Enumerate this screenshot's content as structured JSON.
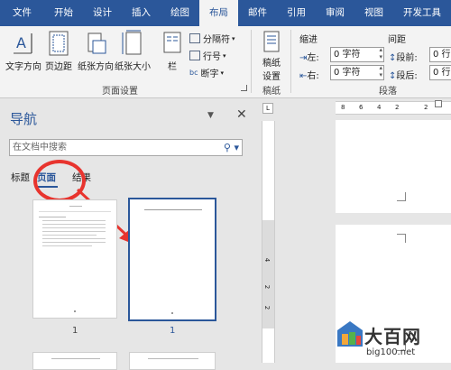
{
  "tabs": [
    "文件",
    "开始",
    "设计",
    "插入",
    "绘图",
    "布局",
    "邮件",
    "引用",
    "审阅",
    "视图",
    "开发工具"
  ],
  "ribbon": {
    "text_direction": "文字方向",
    "margins": "页边距",
    "orientation": "纸张方向",
    "size": "纸张大小",
    "columns": "栏",
    "breaks": "分隔符",
    "line_numbers": "行号",
    "hyphenation": "断字",
    "page_setup_group": "页面设置",
    "manuscript": "稿纸",
    "manuscript_setup": "设置",
    "manuscript_group": "稿纸",
    "indent_header": "缩进",
    "indent_left_label": "左:",
    "indent_left_value": "0 字符",
    "indent_right_label": "右:",
    "indent_right_value": "0 字符",
    "spacing_header": "间距",
    "spacing_before_label": "段前:",
    "spacing_before_value": "0 行",
    "spacing_after_label": "段后:",
    "spacing_after_value": "0 行",
    "paragraph_group": "段落"
  },
  "nav": {
    "title": "导航",
    "search_placeholder": "在文档中搜索",
    "tab_headings": "标题",
    "tab_pages": "页面",
    "tab_results": "结果",
    "thumbnails": [
      {
        "number": "1",
        "selected": false
      },
      {
        "number": "1",
        "selected": true
      }
    ]
  },
  "ruler": {
    "horizontal_ticks": [
      "8",
      "6",
      "4",
      "2",
      "2"
    ],
    "vertical_ticks": [
      "4",
      "2",
      "2"
    ]
  },
  "watermark": {
    "title": "大百网",
    "url": "big100.net"
  },
  "colors": {
    "accent": "#2b579a",
    "highlight": "#e8342e"
  }
}
